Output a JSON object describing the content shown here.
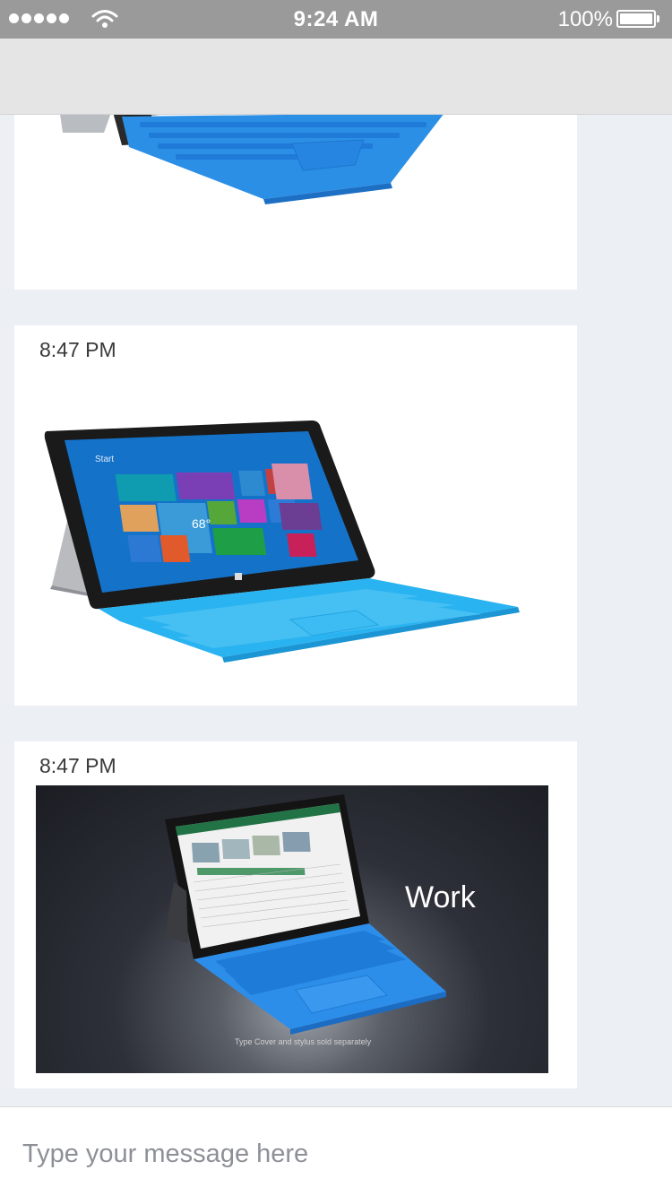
{
  "status_bar": {
    "time": "9:24 AM",
    "battery": "100%"
  },
  "messages": [
    {
      "time": "",
      "image": "tablet-with-blue-keyboard-partial"
    },
    {
      "time": "8:47 PM",
      "image": "surface-tablet-start-screen"
    },
    {
      "time": "8:47 PM",
      "image": "surface-laptop-work-video",
      "overlay_text": "Work",
      "caption": "Type Cover and stylus sold separately"
    }
  ],
  "composer": {
    "placeholder": "Type your message here"
  },
  "colors": {
    "keyboard_blue": "#2b8fe6",
    "screen_blue": "#1572c9",
    "nav_bar": "#e5e5e5",
    "status_bar": "#9a9a9a",
    "chat_background": "#eceff3"
  }
}
